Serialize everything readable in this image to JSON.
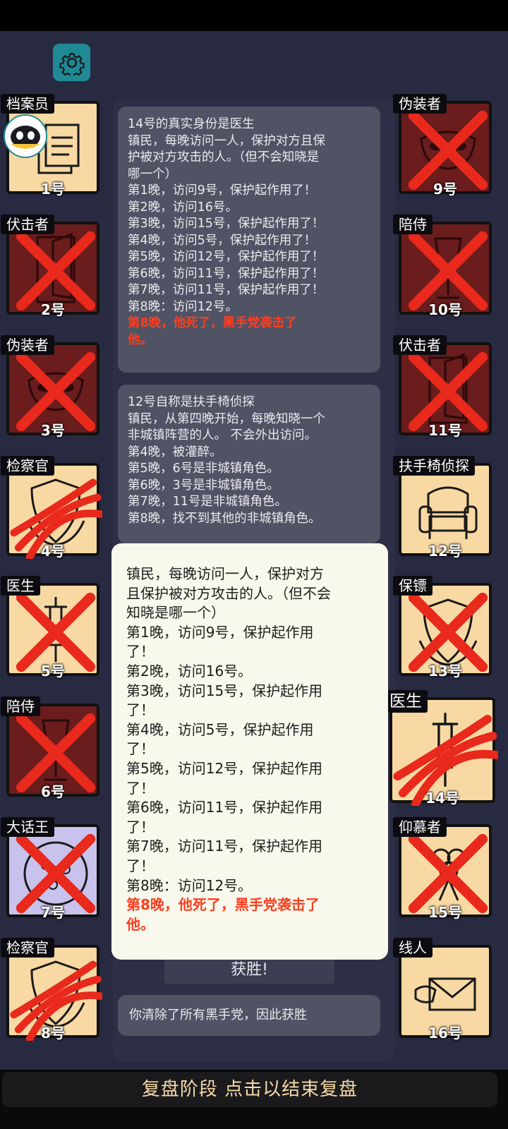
{
  "colors": {
    "background": "#272a40",
    "card_light": "#f8d9a3",
    "card_dark": "#6b1c1c",
    "card_purple": "#c9c2ec",
    "cross": "#e8291c",
    "text_red": "#ff3d1f"
  },
  "settings": {
    "icon": "gear-icon"
  },
  "left_cards": [
    {
      "role": "档案员",
      "number": "1号",
      "theme": "light",
      "mark": "none",
      "icon": "documents-icon"
    },
    {
      "role": "伏击者",
      "number": "2号",
      "theme": "dark",
      "mark": "cross",
      "icon": "door-icon"
    },
    {
      "role": "伪装者",
      "number": "3号",
      "theme": "dark",
      "mark": "cross",
      "icon": "mask-icon"
    },
    {
      "role": "检察官",
      "number": "4号",
      "theme": "light",
      "mark": "claw",
      "icon": "shield-icon"
    },
    {
      "role": "医生",
      "number": "5号",
      "theme": "light",
      "mark": "cross",
      "icon": "syringe-icon"
    },
    {
      "role": "陪侍",
      "number": "6号",
      "theme": "dark",
      "mark": "cross",
      "icon": "wineglass-icon"
    },
    {
      "role": "大话王",
      "number": "7号",
      "theme": "purple",
      "mark": "cross",
      "icon": "pizza-icon"
    },
    {
      "role": "检察官",
      "number": "8号",
      "theme": "light",
      "mark": "claw",
      "icon": "shield-icon"
    }
  ],
  "right_cards": [
    {
      "role": "伪装者",
      "number": "9号",
      "theme": "dark",
      "mark": "cross",
      "icon": "mask-icon"
    },
    {
      "role": "陪侍",
      "number": "10号",
      "theme": "dark",
      "mark": "cross",
      "icon": "wineglass-icon"
    },
    {
      "role": "伏击者",
      "number": "11号",
      "theme": "dark",
      "mark": "cross",
      "icon": "door-icon"
    },
    {
      "role": "扶手椅侦探",
      "number": "12号",
      "theme": "light",
      "mark": "none",
      "icon": "armchair-icon"
    },
    {
      "role": "保镖",
      "number": "13号",
      "theme": "light",
      "mark": "cross",
      "icon": "shield-icon"
    },
    {
      "role": "医生",
      "number": "14号",
      "theme": "light",
      "mark": "claw",
      "icon": "syringe-icon"
    },
    {
      "role": "仰慕者",
      "number": "15号",
      "theme": "light",
      "mark": "cross",
      "icon": "bouquet-icon"
    },
    {
      "role": "线人",
      "number": "16号",
      "theme": "light",
      "mark": "none",
      "icon": "envelope-icon"
    }
  ],
  "panel1": {
    "lines": [
      "14号的真实身份是医生",
      "镇民，每晚访问一人，保护对方且保",
      "护被对方攻击的人。（但不会知晓是",
      "哪一个）",
      "第1晚，访问9号，保护起作用了！",
      "第2晚，访问16号。",
      "第3晚，访问15号，保护起作用了！",
      "第4晚，访问5号，保护起作用了！",
      "第5晚，访问12号，保护起作用了！",
      "第6晚，访问11号，保护起作用了！",
      "第7晚，访问11号，保护起作用了！",
      "第8晚：访问12号。"
    ],
    "red_lines": [
      "第8晚，他死了，黑手党袭击了",
      "他。"
    ]
  },
  "panel2": {
    "lines": [
      "12号自称是扶手椅侦探",
      "镇民，从第四晚开始，每晚知晓一个",
      "非城镇阵营的人。 不会外出访问。",
      "第4晚，被灌醉。",
      "第5晚，6号是非城镇角色。",
      "第6晚，3号是非城镇角色。",
      "第7晚，11号是非城镇角色。",
      "第8晚，找不到其他的非城镇角色。"
    ]
  },
  "popup": {
    "lines": [
      "镇民，每晚访问一人，保护对方",
      "且保护被对方攻击的人。（但不会",
      "知晓是哪一个）",
      "第1晚，访问9号，保护起作用",
      "了！",
      "第2晚，访问16号。",
      "第3晚，访问15号，保护起作用",
      "了！",
      "第4晚，访问5号，保护起作用",
      "了！",
      "第5晚，访问12号，保护起作用",
      "了！",
      "第6晚，访问11号，保护起作用",
      "了！",
      "第7晚，访问11号，保护起作用",
      "了！",
      "第8晚：访问12号。"
    ],
    "red_lines": [
      "第8晚，他死了，黑手党袭击了",
      "他。"
    ]
  },
  "victory": {
    "label": "获胜!",
    "message": "你清除了所有黑手党，因此获胜"
  },
  "bottom": {
    "label": "复盘阶段 点击以结束复盘"
  }
}
